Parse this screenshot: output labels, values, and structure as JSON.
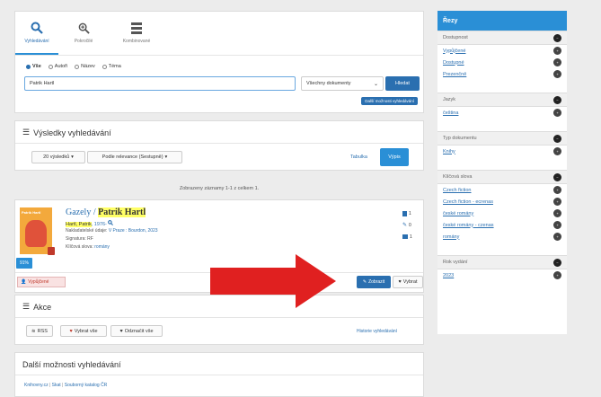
{
  "search": {
    "tabs": [
      "Vyhledávání",
      "Pokročilé",
      "Kombinované"
    ],
    "radios": [
      "Vše",
      "Autoři",
      "Název",
      "Téma"
    ],
    "query": "Patrik Hartl",
    "doc_type": "Všechny dokumenty",
    "submit": "Hledat",
    "more_options": "Další možnosti vyhledávání"
  },
  "results": {
    "title": "Výsledky vyhledávání",
    "per_page": "20 výsledků",
    "sort": "Podle relevance (Sestupně)",
    "view_table": "Tabulka",
    "view_list": "Výpis",
    "summary": "Zobrazeny záznamy 1-1 z celkem 1.",
    "item": {
      "title_prefix": "Gazely / ",
      "title_author": "Patrik Hartl",
      "author": "Hartl, Patrik",
      "author_year": ", 1976-",
      "publisher_label": "Nakladatelské údaje: ",
      "publisher": "V Praze : Bourdon, 2023",
      "signature": "Signatura: RF",
      "keywords_label": "Klíčová slova: ",
      "keywords": "romány",
      "match": "91%",
      "availability": "Vypůjčené",
      "side_counts": [
        "1",
        "0",
        "1"
      ],
      "cover_text": "Patrik Hartl"
    },
    "show_button": "Zobrazit",
    "select_button": "Vybrat"
  },
  "actions": {
    "title": "Akce",
    "rss": "RSS",
    "select_all": "Vybrat vše",
    "unmark_all": "Odznačit vše",
    "history": "Historie vyhledávání"
  },
  "more": {
    "title": "Další možnosti vyhledávání",
    "links": [
      "Knihovny.cz",
      "Skat",
      "Souborný katalog ČR"
    ]
  },
  "facets": {
    "title": "Řezy",
    "groups": [
      {
        "name": "Dostupnost",
        "items": [
          "Vypůjčené",
          "Dostupné",
          "Prezenčně"
        ]
      },
      {
        "name": "Jazyk",
        "items": [
          "čeština"
        ]
      },
      {
        "name": "Typ dokumentu",
        "items": [
          "Knihy"
        ]
      },
      {
        "name": "Klíčová slova",
        "items": [
          "Czech fiction",
          "Czech fiction - ecrenas",
          "české romány",
          "české romány - czenas",
          "romány"
        ]
      },
      {
        "name": "Rok vydání",
        "items": [
          "2023"
        ]
      }
    ]
  },
  "colors": {
    "accent": "#2a8fd6",
    "arrow": "#e02020",
    "highlight": "#ffff66"
  }
}
